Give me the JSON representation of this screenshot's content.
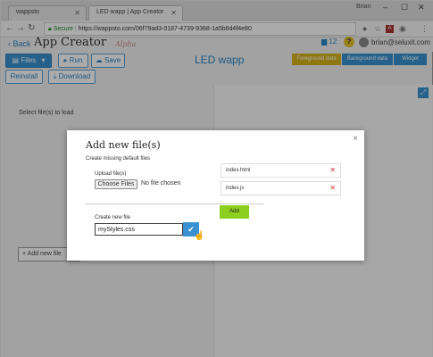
{
  "browser": {
    "tabs": [
      {
        "label": "wappsto"
      },
      {
        "label": "LED wapp | App Creator"
      }
    ],
    "profile": "Brian",
    "address": {
      "secure_label": "Secure",
      "url": "https://wappsto.com/06f79ad3-0187-4739-9368-1a5b6d4f4e80"
    }
  },
  "header": {
    "back_label": "Back",
    "app_title": "App Creator",
    "alpha_tag": "Alpha",
    "notifications": "12",
    "help": "?",
    "user_email": "brian@seluxit.com"
  },
  "toolbar": {
    "files_label": "Files",
    "run_label": "Run",
    "save_label": "Save",
    "reinstall_label": "Reinstall",
    "download_label": "Download",
    "wapp_title": "LED wapp",
    "segments": [
      {
        "label": "Foreground data",
        "color": "#d6b41c"
      },
      {
        "label": "Background data",
        "color": "#3a91d1"
      },
      {
        "label": "Widget",
        "color": "#3a91d1"
      }
    ]
  },
  "workspace": {
    "select_label": "Select file(s) to load",
    "add_new_label": "+ Add new file"
  },
  "modal": {
    "title": "Add new file(s)",
    "subtitle": "Create missing default files",
    "upload_label": "Upload file(s)",
    "choose_files_label": "Choose Files",
    "no_file_label": "No file chosen",
    "create_label": "Create new file",
    "new_file_value": "myStyles.css",
    "files": [
      {
        "name": "index.html"
      },
      {
        "name": "index.js"
      }
    ],
    "add_label": "Add"
  },
  "colors": {
    "accent": "#3a91d1",
    "add_button": "#8dcf1f",
    "foreground_tab": "#d6b41c"
  }
}
